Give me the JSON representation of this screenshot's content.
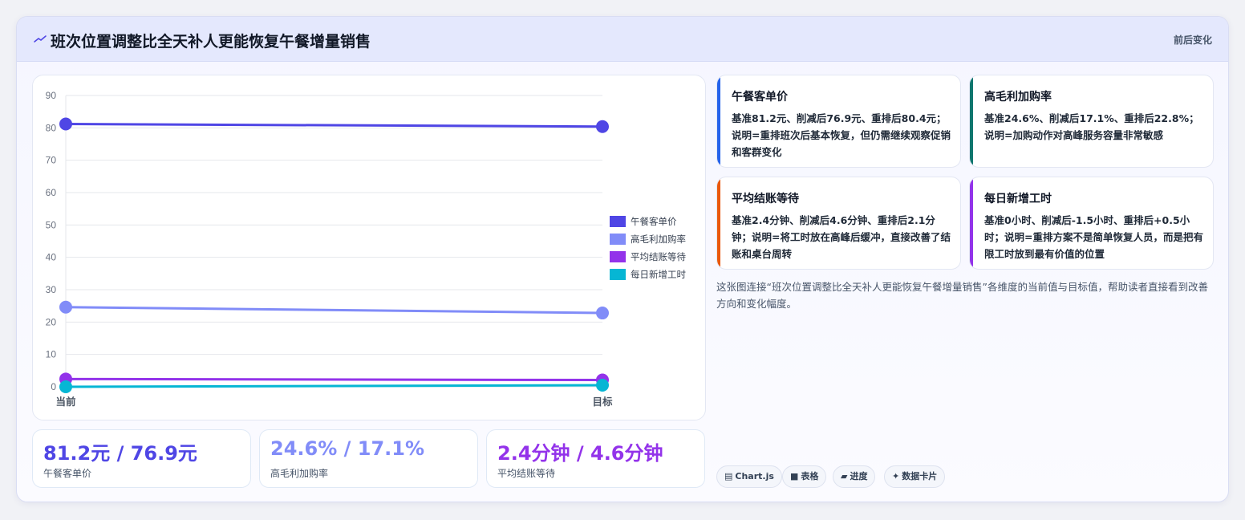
{
  "header": {
    "title": "班次位置调整比全天补人更能恢复午餐增量销售",
    "right_label": "前后变化"
  },
  "chart_data": {
    "type": "line",
    "categories": [
      "当前",
      "目标"
    ],
    "ylim": [
      0,
      90
    ],
    "yticks": [
      0,
      10,
      20,
      30,
      40,
      50,
      60,
      70,
      80,
      90
    ],
    "grid": true,
    "legend_position": "right",
    "series": [
      {
        "name": "午餐客单价",
        "color": "#4f46e5",
        "values": [
          81.2,
          80.4
        ]
      },
      {
        "name": "高毛利加购率",
        "color": "#818cf8",
        "values": [
          24.6,
          22.8
        ]
      },
      {
        "name": "平均结账等待",
        "color": "#9333ea",
        "values": [
          2.4,
          2.1
        ]
      },
      {
        "name": "每日新增工时",
        "color": "#06b6d4",
        "values": [
          0,
          0.5
        ]
      }
    ]
  },
  "kpis": [
    {
      "value": "81.2元 / 76.9元",
      "label": "午餐客单价",
      "color": "#4f46e5"
    },
    {
      "value": "24.6% / 17.1%",
      "label": "高毛利加购率",
      "color": "#818cf8"
    },
    {
      "value": "2.4分钟 / 4.6分钟",
      "label": "平均结账等待",
      "color": "#9333ea"
    }
  ],
  "info_cards": [
    {
      "title": "午餐客单价",
      "desc": "基准81.2元、削减后76.9元、重排后80.4元；说明=重排班次后基本恢复，但仍需继续观察促销和客群变化",
      "color": "#2563eb"
    },
    {
      "title": "高毛利加购率",
      "desc": "基准24.6%、削减后17.1%、重排后22.8%；说明=加购动作对高峰服务容量非常敏感",
      "color": "#0f766e"
    },
    {
      "title": "平均结账等待",
      "desc": "基准2.4分钟、削减后4.6分钟、重排后2.1分钟；说明=将工时放在高峰后缓冲，直接改善了结账和桌台周转",
      "color": "#ea580c"
    },
    {
      "title": "每日新增工时",
      "desc": "基准0小时、削减后-1.5小时、重排后+0.5小时；说明=重排方案不是简单恢复人员，而是把有限工时放到最有价值的位置",
      "color": "#9333ea"
    }
  ],
  "description": "这张图连接“班次位置调整比全天补人更能恢复午餐增量销售”各维度的当前值与目标值，帮助读者直接看到改善方向和变化幅度。",
  "tags": [
    {
      "icon": "▤",
      "label": "Chart.js",
      "icon_name": "chart-icon"
    },
    {
      "icon": "■",
      "label": "表格",
      "icon_name": "table-icon"
    },
    {
      "icon": "▰",
      "label": "进度",
      "icon_name": "progress-icon"
    },
    {
      "icon": "✦",
      "label": "数据卡片",
      "icon_name": "sparkle-icon"
    }
  ]
}
